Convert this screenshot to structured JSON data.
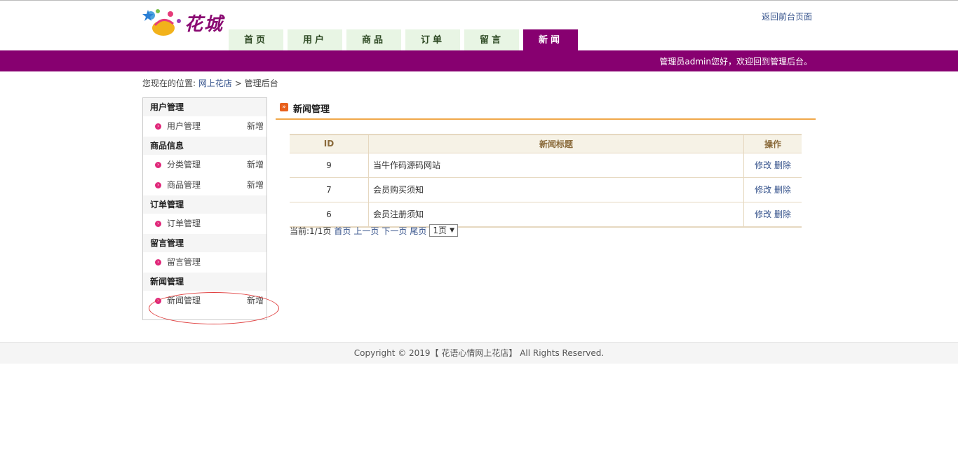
{
  "brand": {
    "logo_text": "花城"
  },
  "header": {
    "back_link": "返回前台页面",
    "welcome": "管理员admin您好，欢迎回到管理后台。"
  },
  "nav": {
    "tabs": [
      {
        "label": "首页"
      },
      {
        "label": "用户"
      },
      {
        "label": "商品"
      },
      {
        "label": "订单"
      },
      {
        "label": "留言"
      },
      {
        "label": "新闻"
      }
    ],
    "active": "新闻"
  },
  "breadcrumb": {
    "prefix": "您现在的位置:",
    "home": "网上花店",
    "sep": ">",
    "current": "管理后台"
  },
  "sidebar": {
    "groups": [
      {
        "title": "用户管理",
        "items": [
          {
            "label": "用户管理",
            "action": "新增"
          }
        ]
      },
      {
        "title": "商品信息",
        "items": [
          {
            "label": "分类管理",
            "action": "新增"
          },
          {
            "label": "商品管理",
            "action": "新增"
          }
        ]
      },
      {
        "title": "订单管理",
        "items": [
          {
            "label": "订单管理",
            "action": ""
          }
        ]
      },
      {
        "title": "留言管理",
        "items": [
          {
            "label": "留言管理",
            "action": ""
          }
        ]
      },
      {
        "title": "新闻管理",
        "items": [
          {
            "label": "新闻管理",
            "action": "新增"
          }
        ]
      }
    ]
  },
  "main": {
    "title": "新闻管理",
    "table": {
      "headers": {
        "id": "ID",
        "title": "新闻标题",
        "ops": "操作"
      },
      "rows": [
        {
          "id": "9",
          "title": "当牛作码源码网站",
          "edit": "修改",
          "del": "删除"
        },
        {
          "id": "7",
          "title": "会员购买须知",
          "edit": "修改",
          "del": "删除"
        },
        {
          "id": "6",
          "title": "会员注册须知",
          "edit": "修改",
          "del": "删除"
        }
      ]
    },
    "pager": {
      "status": "当前:1/1页",
      "first": "首页",
      "prev": "上一页",
      "next": "下一页",
      "last": "尾页",
      "select": "1页"
    }
  },
  "footer": {
    "text": "Copyright © 2019【 花语心情网上花店】 All Rights Reserved."
  },
  "colors": {
    "accent": "#870070",
    "tab_bg": "#e8f5e4",
    "rule": "#f0a84a",
    "link": "#36538c"
  }
}
